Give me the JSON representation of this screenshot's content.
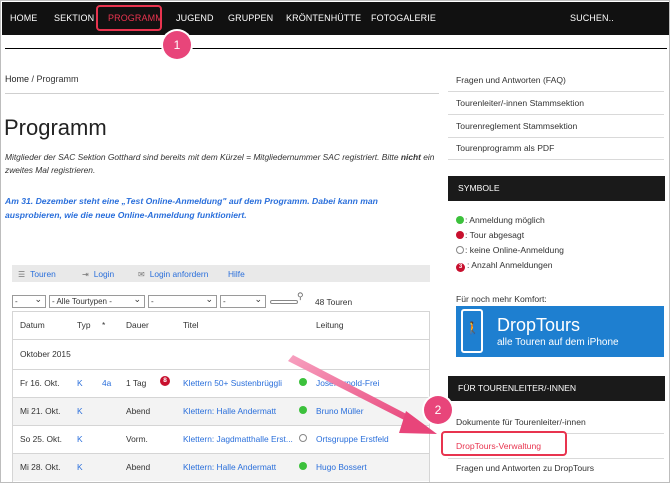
{
  "nav": {
    "items": [
      "HOME",
      "SEKTION",
      "PROGRAMM",
      "JUGEND",
      "GRUPPEN",
      "KRÖNTENHÜTTE",
      "FOTOGALERIE"
    ],
    "search": "SUCHEN..",
    "active": "PROGRAMM"
  },
  "breadcrumb": {
    "home": "Home",
    "separator": " / ",
    "current": "Programm"
  },
  "page": {
    "title": "Programm",
    "intro_part1": "Mitglieder der SAC Sektion Gotthard sind bereits mit dem Kürzel = Mitgliedernummer SAC registriert. Bitte ",
    "intro_bold": "nicht",
    "intro_part2": " ein zweites Mal registrieren.",
    "notice": "Am 31. Dezember steht eine „Test Online-Anmeldung\" auf dem Programm. Dabei kann man ausprobieren, wie die neue Online-Anmeldung funktioniert."
  },
  "toolbar": {
    "touren": "Touren",
    "login": "Login",
    "login_anfordern": "Login anfordern",
    "hilfe": "Hilfe"
  },
  "filters": {
    "sel1": "-",
    "sel2": "- Alle Tourtypen -",
    "sel3": "-",
    "sel4": "-",
    "count": "48 Touren"
  },
  "table": {
    "headers": {
      "datum": "Datum",
      "typ": "Typ",
      "star": "*",
      "dauer": "Dauer",
      "titel": "Titel",
      "leitung": "Leitung"
    },
    "month": "Oktober 2015",
    "rows": [
      {
        "datum": "Fr 16. Okt.",
        "typ": "K",
        "star": "4a",
        "dauer": "1 Tag",
        "badge": "8",
        "titel": "Klettern 50+ Sustenbrüggli",
        "status": "green",
        "leitung": "Josef Arnold-Frei"
      },
      {
        "datum": "Mi 21. Okt.",
        "typ": "K",
        "star": "",
        "dauer": "Abend",
        "badge": "",
        "titel": "Klettern: Halle Andermatt",
        "status": "green",
        "leitung": "Bruno Müller"
      },
      {
        "datum": "So 25. Okt.",
        "typ": "K",
        "star": "",
        "dauer": "Vorm.",
        "badge": "",
        "titel": "Klettern: Jagdmatthalle Erst...",
        "status": "empty",
        "leitung": "Ortsgruppe Erstfeld"
      },
      {
        "datum": "Mi 28. Okt.",
        "typ": "K",
        "star": "",
        "dauer": "Abend",
        "badge": "",
        "titel": "Klettern: Halle Andermatt",
        "status": "green",
        "leitung": "Hugo Bossert"
      }
    ]
  },
  "sidebar": {
    "links": [
      "Fragen und Antworten (FAQ)",
      "Tourenleiter/-innen Stammsektion",
      "Tourenreglement Stammsektion",
      "Tourenprogramm als PDF"
    ],
    "symbols_header": "SYMBOLE",
    "symbols": [
      {
        "icon": "green",
        "label": ": Anmeldung möglich"
      },
      {
        "icon": "red",
        "label": ": Tour abgesagt"
      },
      {
        "icon": "empty",
        "label": ": keine Online-Anmeldung"
      },
      {
        "icon": "number",
        "num": "3",
        "label": ": Anzahl Anmeldungen"
      }
    ],
    "comfort": "Für noch mehr Komfort:",
    "droptours_title": "DropTours",
    "droptours_sub": "alle Touren auf dem iPhone",
    "leader_header": "FÜR TOURENLEITER/-INNEN",
    "leader_links": [
      "Dokumente für Tourenleiter/-innen",
      "DropTours-Verwaltung",
      "Fragen und Antworten zu DropTours"
    ]
  },
  "callouts": [
    "1",
    "2"
  ],
  "colors": {
    "accent": "#e8344f",
    "link": "#2a6fdb",
    "callout": "#e8457a",
    "navbar": "#111111"
  }
}
